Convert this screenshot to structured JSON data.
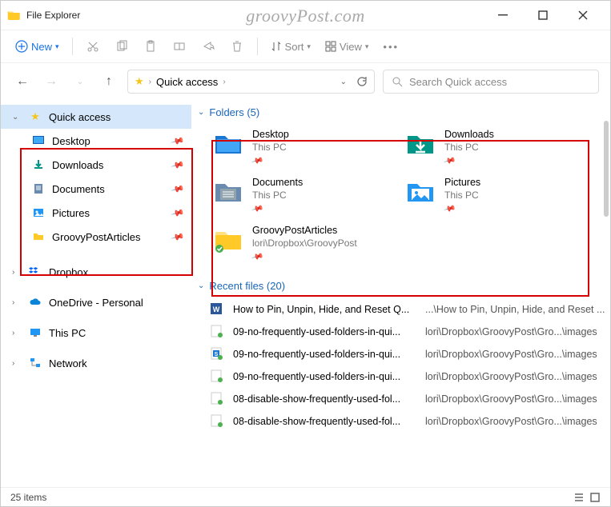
{
  "titlebar": {
    "title": "File Explorer"
  },
  "watermark": "groovyPost.com",
  "toolbar": {
    "new_label": "New",
    "sort_label": "Sort",
    "view_label": "View"
  },
  "nav": {
    "breadcrumb": "Quick access",
    "search_placeholder": "Search Quick access"
  },
  "sidebar": {
    "quick_access": "Quick access",
    "items": [
      {
        "label": "Desktop"
      },
      {
        "label": "Downloads"
      },
      {
        "label": "Documents"
      },
      {
        "label": "Pictures"
      },
      {
        "label": "GroovyPostArticles"
      }
    ],
    "dropbox": "Dropbox",
    "onedrive": "OneDrive - Personal",
    "thispc": "This PC",
    "network": "Network"
  },
  "sections": {
    "folders_hd": "Folders (5)",
    "recent_hd": "Recent files (20)"
  },
  "folders": [
    {
      "name": "Desktop",
      "loc": "This PC"
    },
    {
      "name": "Downloads",
      "loc": "This PC"
    },
    {
      "name": "Documents",
      "loc": "This PC"
    },
    {
      "name": "Pictures",
      "loc": "This PC"
    },
    {
      "name": "GroovyPostArticles",
      "loc": "lori\\Dropbox\\GroovyPost"
    }
  ],
  "files": [
    {
      "name": "How to Pin, Unpin, Hide, and Reset Q...",
      "path": "...\\How to Pin, Unpin, Hide, and Reset ..."
    },
    {
      "name": "09-no-frequently-used-folders-in-qui...",
      "path": "lori\\Dropbox\\GroovyPost\\Gro...\\images"
    },
    {
      "name": "09-no-frequently-used-folders-in-qui...",
      "path": "lori\\Dropbox\\GroovyPost\\Gro...\\images"
    },
    {
      "name": "09-no-frequently-used-folders-in-qui...",
      "path": "lori\\Dropbox\\GroovyPost\\Gro...\\images"
    },
    {
      "name": "08-disable-show-frequently-used-fol...",
      "path": "lori\\Dropbox\\GroovyPost\\Gro...\\images"
    },
    {
      "name": "08-disable-show-frequently-used-fol...",
      "path": "lori\\Dropbox\\GroovyPost\\Gro...\\images"
    }
  ],
  "status": {
    "count": "25 items"
  }
}
